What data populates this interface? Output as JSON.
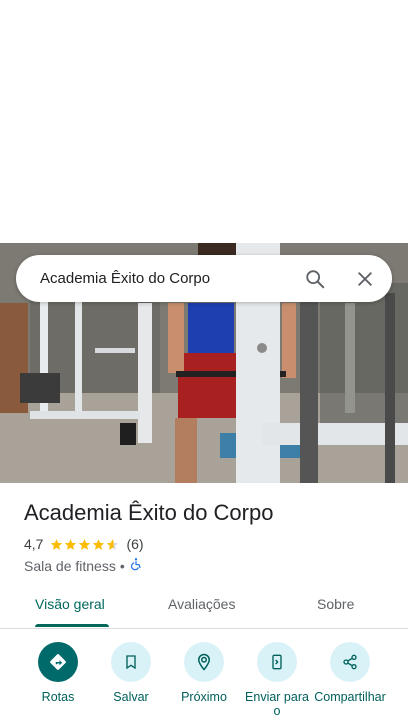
{
  "search": {
    "query": "Academia Êxito do Corpo"
  },
  "place": {
    "title": "Academia Êxito do Corpo",
    "rating": "4,7",
    "rating_value": 4.7,
    "review_count": "(6)",
    "category": "Sala de fitness",
    "separator": "•"
  },
  "tabs": [
    {
      "label": "Visão geral",
      "active": true
    },
    {
      "label": "Avaliações",
      "active": false
    },
    {
      "label": "Sobre",
      "active": false
    }
  ],
  "actions": [
    {
      "label": "Rotas",
      "icon": "directions-icon"
    },
    {
      "label": "Salvar",
      "icon": "bookmark-icon"
    },
    {
      "label": "Próximo",
      "icon": "nearby-icon"
    },
    {
      "label": "Enviar para o",
      "icon": "send-to-phone-icon"
    },
    {
      "label": "Compartilhar",
      "icon": "share-icon"
    }
  ],
  "colors": {
    "accent": "#00695c",
    "primary_action": "#006a6b",
    "action_bg": "#d9f2f8",
    "star": "#fbbc04"
  }
}
